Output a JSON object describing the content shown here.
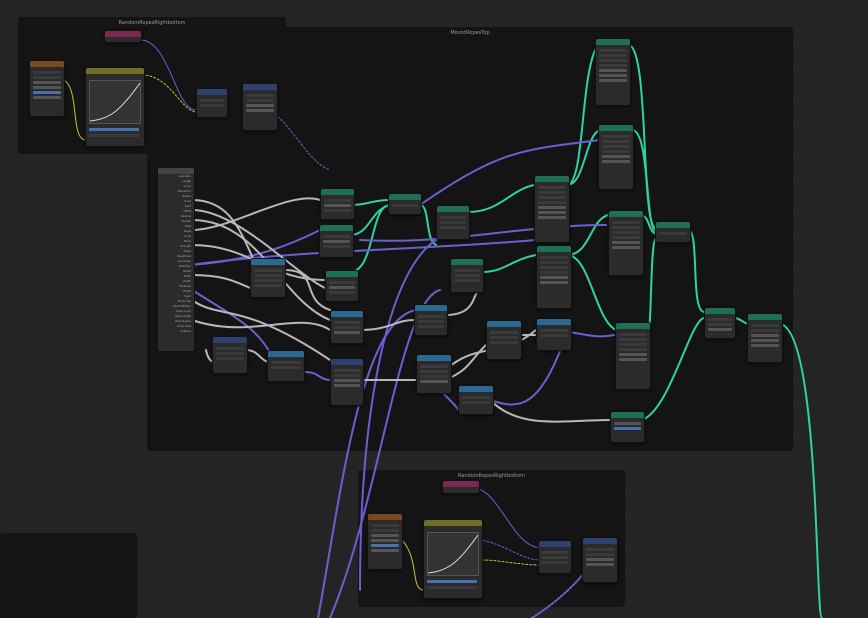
{
  "frames": [
    {
      "id": "frame_top_left",
      "title": "RandomRopesRightbottom"
    },
    {
      "id": "frame_main",
      "title": "MountRopesTop"
    },
    {
      "id": "frame_bottom",
      "title": "RandomRopesRightbottom"
    }
  ],
  "node_types": {
    "teal": "Geometry",
    "navy": "Math",
    "blue": "Vector",
    "olive": "Float Curve",
    "brown": "Random Value",
    "pink": "Value"
  },
  "colors": {
    "canvas": "#242424",
    "frame": "#141414",
    "wire_geometry": "#2fd3a0",
    "wire_vector": "#6a5fd0",
    "wire_float": "#a8a8a8",
    "wire_value": "#c8c040"
  },
  "group_input": {
    "sockets": [
      "Geometry",
      "Length",
      "Curve",
      "Resolution",
      "Radius",
      "Count",
      "Seed",
      "Offset",
      "Spacing",
      "Density",
      "Twist",
      "Angle",
      "Scale",
      "Noise",
      "Strength",
      "Detail",
      "Roughness",
      "Lacunarity",
      "Distortion",
      "Height",
      "Width",
      "Depth",
      "Thickness",
      "Profile",
      "Taper",
      "Mount Top",
      "Mount Bottom",
      "Rope Count",
      "Rope Length",
      "Rope Radius",
      "Rope Seed",
      "Collision"
    ]
  }
}
